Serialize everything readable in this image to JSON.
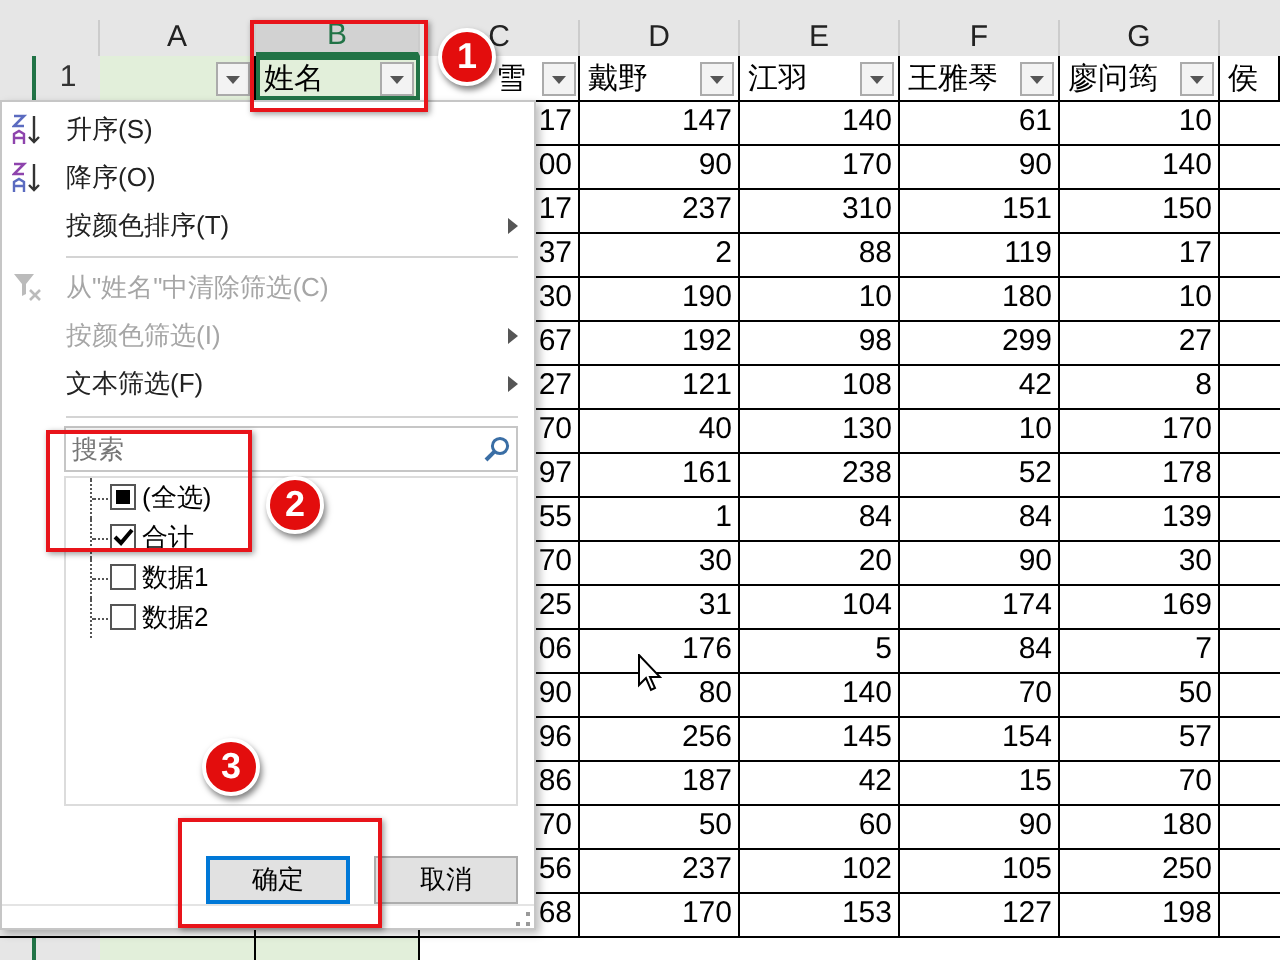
{
  "sheet": {
    "columns": [
      {
        "letter": "A",
        "selected": false
      },
      {
        "letter": "B",
        "selected": true
      },
      {
        "letter": "C",
        "selected": false
      },
      {
        "letter": "D",
        "selected": false
      },
      {
        "letter": "E",
        "selected": false
      },
      {
        "letter": "F",
        "selected": false
      },
      {
        "letter": "G",
        "selected": false
      }
    ],
    "header_row": {
      "number": "1",
      "cells": [
        {
          "filter": true,
          "selected": false,
          "highlighted": true
        },
        {
          "text": "姓名",
          "filter": true,
          "selected": true,
          "highlighted": true
        },
        {
          "text": "雪",
          "filter": true,
          "selected": false,
          "highlighted": false
        },
        {
          "text": "戴野",
          "filter": true,
          "selected": false,
          "highlighted": false
        },
        {
          "text": "江羽",
          "filter": true,
          "selected": false,
          "highlighted": false
        },
        {
          "text": "王雅琴",
          "filter": true,
          "selected": false,
          "highlighted": false
        },
        {
          "text": "廖问筠",
          "filter": true,
          "selected": false,
          "highlighted": false
        },
        {
          "text": "侯",
          "filter": false,
          "selected": false,
          "highlighted": false
        }
      ]
    },
    "rows": [
      {
        "cells": [
          "17",
          "147",
          "140",
          "61",
          "10"
        ]
      },
      {
        "cells": [
          "00",
          "90",
          "170",
          "90",
          "140"
        ]
      },
      {
        "cells": [
          "17",
          "237",
          "310",
          "151",
          "150"
        ]
      },
      {
        "cells": [
          "37",
          "2",
          "88",
          "119",
          "17"
        ]
      },
      {
        "cells": [
          "30",
          "190",
          "10",
          "180",
          "10"
        ]
      },
      {
        "cells": [
          "67",
          "192",
          "98",
          "299",
          "27"
        ]
      },
      {
        "cells": [
          "27",
          "121",
          "108",
          "42",
          "8"
        ]
      },
      {
        "cells": [
          "70",
          "40",
          "130",
          "10",
          "170"
        ]
      },
      {
        "cells": [
          "97",
          "161",
          "238",
          "52",
          "178"
        ]
      },
      {
        "cells": [
          "55",
          "1",
          "84",
          "84",
          "139"
        ]
      },
      {
        "cells": [
          "70",
          "30",
          "20",
          "90",
          "30"
        ]
      },
      {
        "cells": [
          "25",
          "31",
          "104",
          "174",
          "169"
        ]
      },
      {
        "cells": [
          "06",
          "176",
          "5",
          "84",
          "7"
        ]
      },
      {
        "cells": [
          "90",
          "80",
          "140",
          "70",
          "50"
        ]
      },
      {
        "cells": [
          "96",
          "256",
          "145",
          "154",
          "57"
        ]
      },
      {
        "cells": [
          "86",
          "187",
          "42",
          "15",
          "70"
        ]
      },
      {
        "cells": [
          "70",
          "50",
          "60",
          "90",
          "180"
        ]
      },
      {
        "cells": [
          "56",
          "237",
          "102",
          "105",
          "250"
        ]
      },
      {
        "cells": [
          "68",
          "170",
          "153",
          "127",
          "198"
        ]
      }
    ]
  },
  "filter_menu": {
    "items": [
      {
        "kind": "sort-asc",
        "label": "升序(S)",
        "disabled": false,
        "submenu": false
      },
      {
        "kind": "sort-desc",
        "label": "降序(O)",
        "disabled": false,
        "submenu": false
      },
      {
        "kind": "plain",
        "label": "按颜色排序(T)",
        "disabled": false,
        "submenu": true
      },
      {
        "kind": "clear",
        "label": "从\"姓名\"中清除筛选(C)",
        "disabled": true,
        "submenu": false
      },
      {
        "kind": "plain",
        "label": "按颜色筛选(I)",
        "disabled": true,
        "submenu": true
      },
      {
        "kind": "plain",
        "label": "文本筛选(F)",
        "disabled": false,
        "submenu": true
      }
    ],
    "search": {
      "placeholder": "搜索"
    },
    "values": [
      {
        "label": "(全选)",
        "checked": true,
        "partial": true
      },
      {
        "label": "合计",
        "checked": true
      },
      {
        "label": "数据1",
        "checked": false
      },
      {
        "label": "数据2",
        "checked": false
      }
    ],
    "buttons": [
      {
        "label": "确定",
        "focused": true
      },
      {
        "label": "取消",
        "focused": false
      }
    ]
  },
  "annotations": [
    {
      "label": "1"
    },
    {
      "label": "2"
    },
    {
      "label": "3"
    }
  ]
}
